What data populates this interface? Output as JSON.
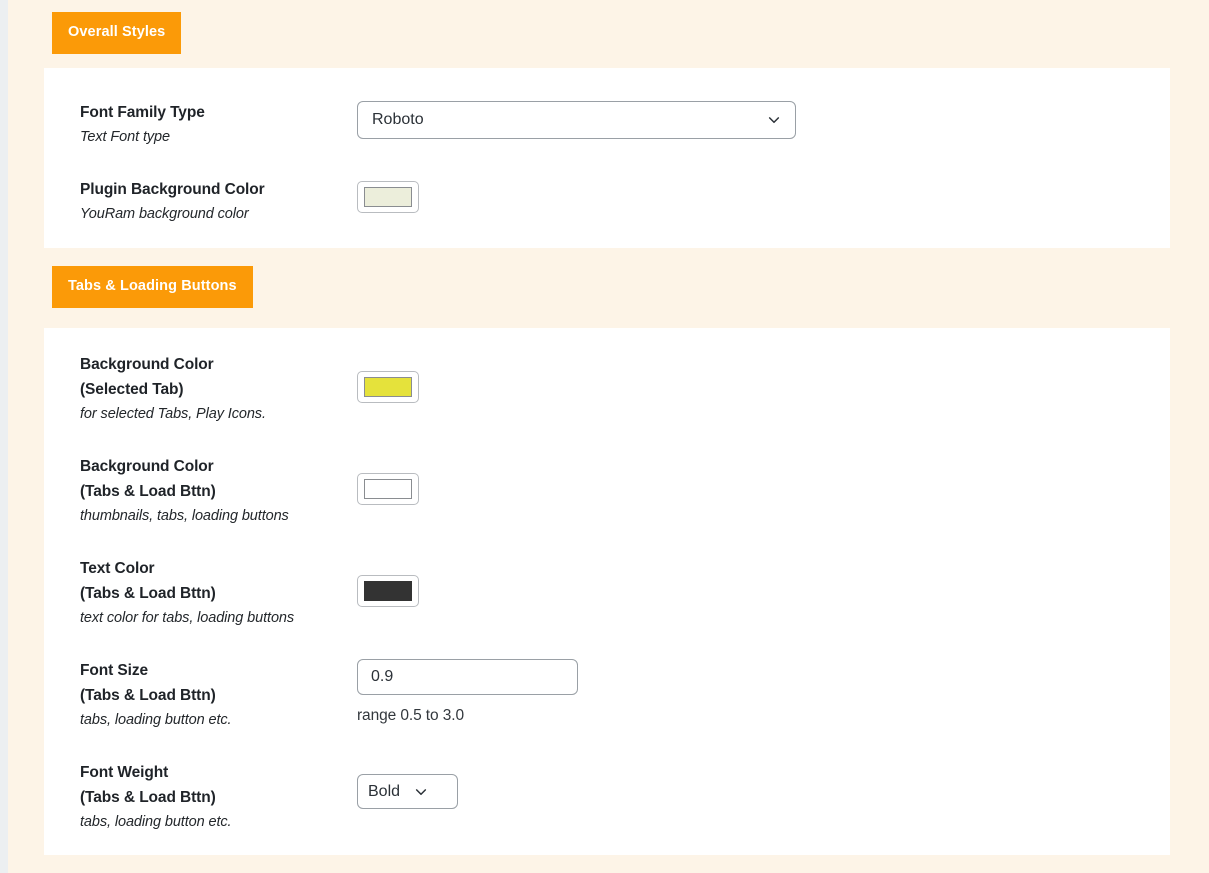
{
  "theme": {
    "accent_orange": "#fb9a08",
    "page_background": "#fdf4e7",
    "card_background": "#ffffff"
  },
  "sections": [
    {
      "badge_label": "Overall Styles",
      "rows": [
        {
          "label": "Font Family Type",
          "description": "Text Font type",
          "control": "select",
          "value": "Roboto",
          "icon": "chevron-down-icon"
        },
        {
          "label": "Plugin Background Color",
          "description": "YouRam background color",
          "control": "color",
          "value": "#eceedb"
        }
      ]
    },
    {
      "badge_label": "Tabs & Loading Buttons",
      "rows": [
        {
          "label_line1": "Background Color",
          "label_line2": "(Selected Tab)",
          "description": "for selected Tabs, Play Icons.",
          "control": "color",
          "value": "#e5e23b"
        },
        {
          "label_line1": "Background Color",
          "label_line2": "(Tabs & Load Bttn)",
          "description": "thumbnails, tabs, loading buttons",
          "control": "color",
          "value": "#ffffff"
        },
        {
          "label_line1": "Text Color",
          "label_line2": "(Tabs & Load Bttn)",
          "description": "text color for tabs, loading buttons",
          "control": "color",
          "value": "#333333"
        },
        {
          "label_line1": "Font Size",
          "label_line2": "(Tabs & Load Bttn)",
          "description": "tabs, loading button etc.",
          "control": "text",
          "value": "0.9",
          "hint": "range 0.5 to 3.0"
        },
        {
          "label_line1": "Font Weight",
          "label_line2": "(Tabs & Load Bttn)",
          "description": "tabs, loading button etc.",
          "control": "select",
          "value": "Bold",
          "icon": "chevron-down-icon"
        }
      ]
    }
  ]
}
